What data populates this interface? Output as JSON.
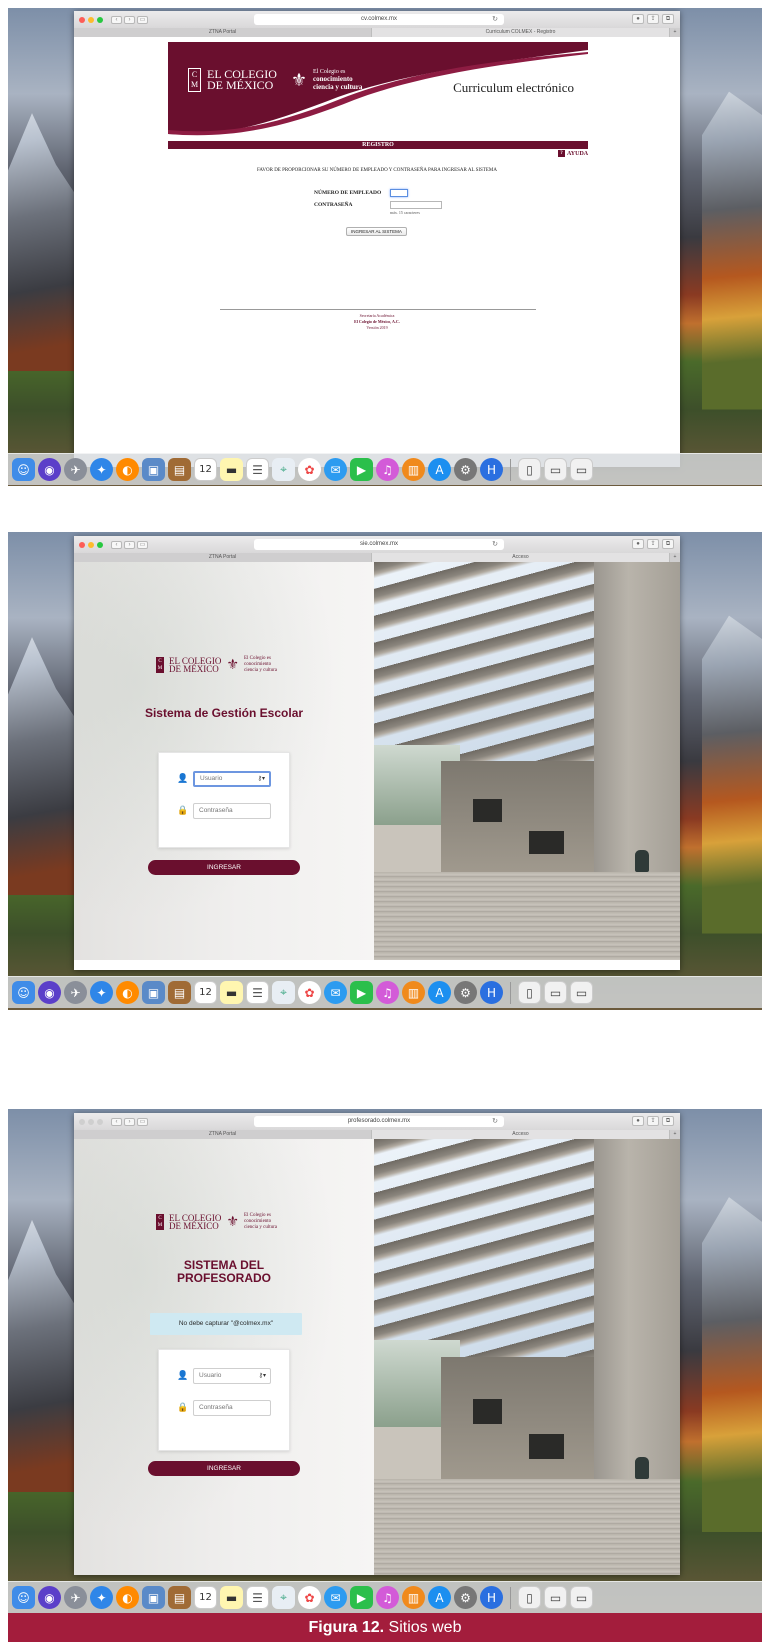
{
  "screens": [
    {
      "url": "cv.colmex.mx",
      "tabs": [
        "ZTNA Portal",
        "Curriculum COLMEX - Registro"
      ],
      "logo": {
        "cm_top": "C",
        "cm_bottom": "M",
        "name_line1": "EL COLEGIO",
        "name_line2": "DE MÉXICO",
        "motto_line1": "El Colegio es",
        "motto_line2": "conocimiento",
        "motto_line3": "ciencia y cultura"
      },
      "header_title": "Curriculum electrónico",
      "section_bar": "REGISTRO",
      "help_label": "AYUDA",
      "help_icon": "?",
      "instructions": "FAVOR DE PROPORCIONAR SU NÚMERO DE EMPLEADO Y CONTRASEÑA PARA INGRESAR AL SISTEMA",
      "employee_label": "NÚMERO DE EMPLEADO",
      "password_label": "CONTRASEÑA",
      "password_hint": "máx. 15 caracteres",
      "submit_button": "INGRESAR AL SISTEMA",
      "footer_line1": "Secretaría Académica",
      "footer_line2": "El Colegio de México, A.C.",
      "footer_line3": "Versión 2019"
    },
    {
      "url": "sie.colmex.mx",
      "tabs": [
        "ZTNA Portal",
        "Acceso"
      ],
      "title": "Sistema de Gestión Escolar",
      "user_placeholder": "Usuario",
      "password_placeholder": "Contraseña",
      "submit_button": "INGRESAR"
    },
    {
      "url": "profesorado.colmex.mx",
      "tabs": [
        "ZTNA Portal",
        "Acceso"
      ],
      "title_line1": "SISTEMA DEL",
      "title_line2": "PROFESORADO",
      "notice": "No debe capturar \"@colmex.mx\"",
      "user_placeholder": "Usuario",
      "password_placeholder": "Contraseña",
      "submit_button": "INGRESAR"
    }
  ],
  "dock_calendar_day": "12",
  "caption_bold": "Figura 12.",
  "caption_text": " Sitios web",
  "colors": {
    "brand": "#6a0f2e",
    "caption_bg": "#a31d3c",
    "notice_bg": "#cfe9f2"
  }
}
